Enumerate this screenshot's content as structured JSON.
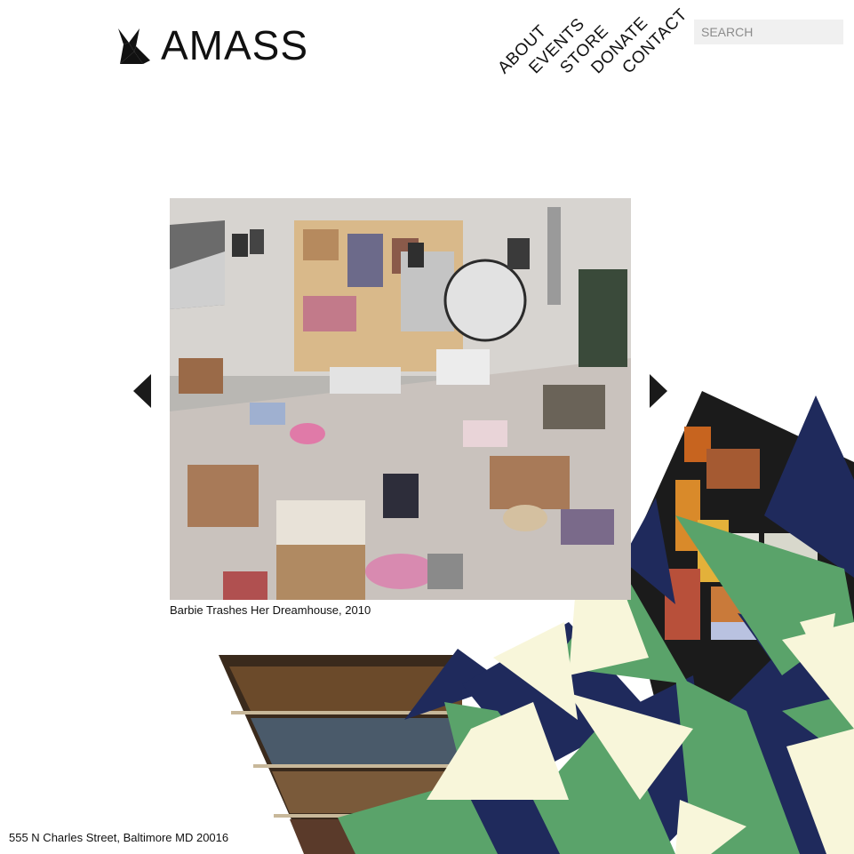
{
  "brand": {
    "name": "AMASS",
    "logo_icon": "bird-logo-icon"
  },
  "nav": [
    {
      "label": "ABOUT"
    },
    {
      "label": "EVENTS"
    },
    {
      "label": "STORE"
    },
    {
      "label": "DONATE"
    },
    {
      "label": "CONTACT"
    }
  ],
  "search": {
    "placeholder": "SEARCH",
    "value": ""
  },
  "slideshow": {
    "caption": "Barbie Trashes Her Dreamhouse, 2010",
    "prev_icon": "triangle-left-icon",
    "next_icon": "triangle-right-icon"
  },
  "footer": {
    "address": "555 N Charles Street, Baltimore MD 20016"
  },
  "colors": {
    "navy": "#1f2a5c",
    "green": "#5aa36a",
    "cream": "#f8f6da",
    "ink": "#111111"
  }
}
